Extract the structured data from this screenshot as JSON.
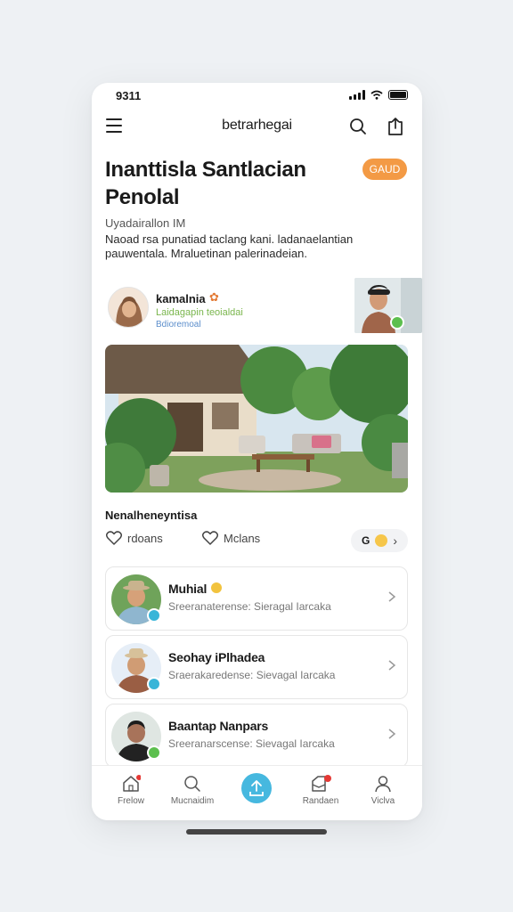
{
  "status": {
    "time": "9311"
  },
  "header": {
    "app_title": "betrarhegai"
  },
  "article": {
    "headline": "Inanttisla Santlacian Penolal",
    "badge": "GAUD",
    "subtitle": "Uyadairallon IM",
    "description": "Naoad rsa punatiad taclang kani. ladanaelantian pauwentala. Mraluetinan palerinadeian."
  },
  "author": {
    "name": "kamalnia",
    "tagline": "Laidagapin teoialdai",
    "sub": "Bdioremoal"
  },
  "section": {
    "title": "Nenalheneyntisa"
  },
  "actions": {
    "like_label": "rdoans",
    "save_label": "Mclans",
    "reaction_count": "G"
  },
  "people": [
    {
      "name": "Muhial",
      "meta": "Sreeranaterense: Sieragal Iarcaka",
      "badge_color": "#39b5d8"
    },
    {
      "name": "Seohay iPlhadea",
      "meta": "Sraerakaredense: Sievagal Iarcaka",
      "badge_color": "#39b5d8"
    },
    {
      "name": "Baantap Nanpars",
      "meta": "Sreeranarscense: Sievagal Iarcaka",
      "badge_color": "#5cbf4e"
    }
  ],
  "nav": [
    {
      "label": "Frelow"
    },
    {
      "label": "Mucnaidim"
    },
    {
      "label": ""
    },
    {
      "label": "Randaen"
    },
    {
      "label": "Viclva"
    }
  ],
  "colors": {
    "accent": "#46b8df",
    "badge": "#f39a45",
    "notify": "#e53935"
  }
}
